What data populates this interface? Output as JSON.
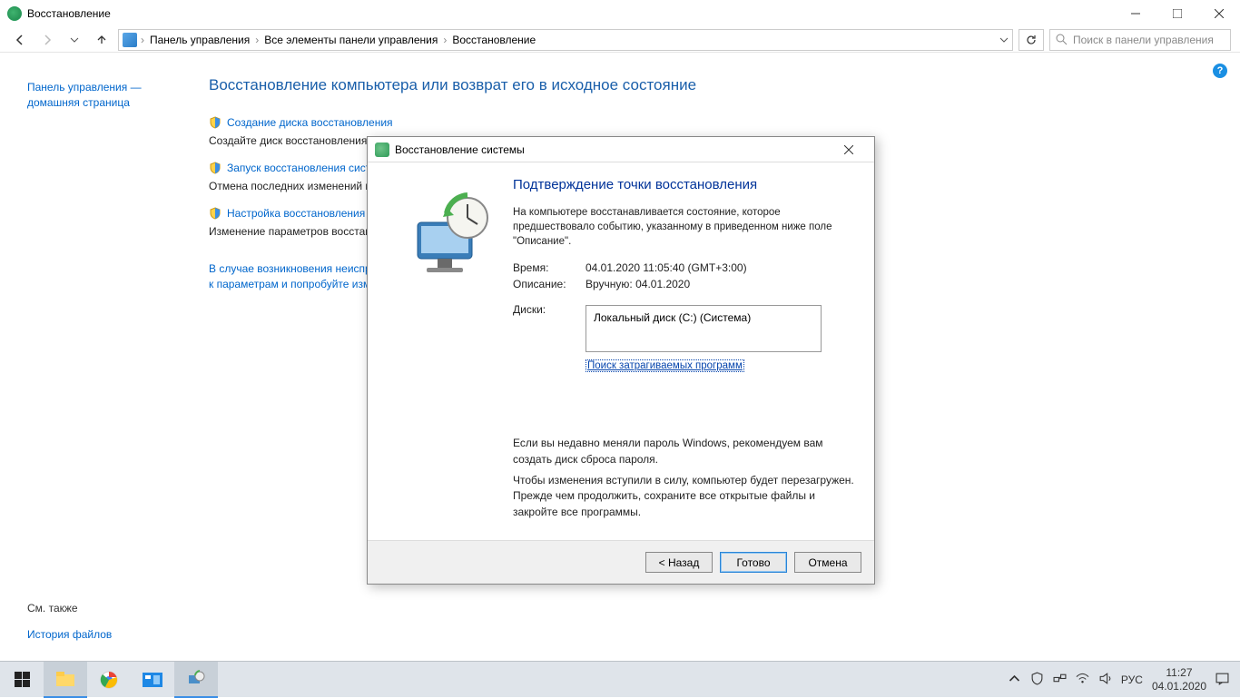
{
  "window": {
    "title": "Восстановление"
  },
  "breadcrumb": {
    "root": "Панель управления",
    "mid": "Все элементы панели управления",
    "leaf": "Восстановление"
  },
  "search": {
    "placeholder": "Поиск в панели управления"
  },
  "sidebar": {
    "home": "Панель управления — домашняя страница",
    "see_also": "См. также",
    "file_history": "История файлов"
  },
  "content": {
    "heading": "Восстановление компьютера или возврат его в исходное состояние",
    "items": [
      {
        "title": "Создание диска восстановления",
        "desc": "Создайте диск восстановления для устранения неисправностей, когда компьютер не запускается."
      },
      {
        "title": "Запуск восстановления системы",
        "desc": "Отмена последних изменений в системе, однако такие файлы, как документы, изображения и музыка, остаются без изменений."
      },
      {
        "title": "Настройка восстановления системы",
        "desc": "Изменение параметров восстановления, использование дискового пространства и создание или удаление точек восстановления."
      }
    ],
    "troubleshoot": "В случае возникновения неисправностей перейдите к параметрам и попробуйте изменить их."
  },
  "dialog": {
    "title": "Восстановление системы",
    "heading": "Подтверждение точки восстановления",
    "intro": "На компьютере восстанавливается состояние, которое предшествовало событию, указанному в приведенном ниже поле \"Описание\".",
    "time_label": "Время:",
    "time_value": "04.01.2020 11:05:40 (GMT+3:00)",
    "desc_label": "Описание:",
    "desc_value": "Вручную: 04.01.2020",
    "disks_label": "Диски:",
    "disk_value": "Локальный диск (C:) (Система)",
    "scan_link": "Поиск затрагиваемых программ",
    "note1": "Если вы недавно меняли пароль Windows, рекомендуем вам создать диск сброса пароля.",
    "note2": "Чтобы изменения вступили в силу, компьютер будет перезагружен. Прежде чем продолжить, сохраните все открытые файлы и закройте все программы.",
    "back": "< Назад",
    "finish": "Готово",
    "cancel": "Отмена"
  },
  "tray": {
    "lang": "РУС",
    "time": "11:27",
    "date": "04.01.2020"
  }
}
